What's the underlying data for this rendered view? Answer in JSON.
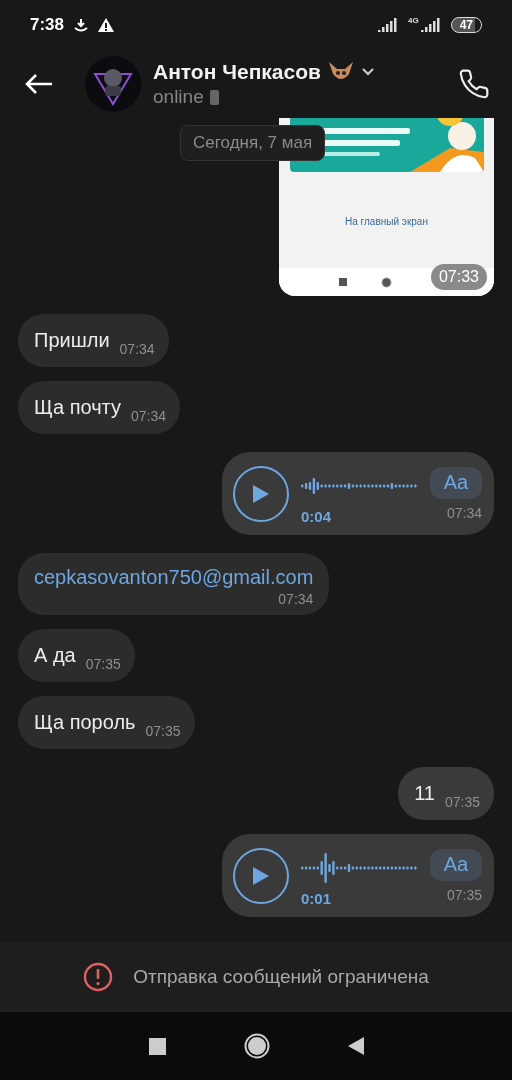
{
  "status_bar": {
    "time": "7:38",
    "network": "4G",
    "battery": "47"
  },
  "header": {
    "name": "Антон Чепкасов",
    "status": "online"
  },
  "date_divider": "Сегодня, 7 мая",
  "messages": [
    {
      "kind": "screenshot",
      "outgoing": true,
      "link": "На главный экран",
      "time": "07:33"
    },
    {
      "kind": "text",
      "outgoing": false,
      "text": "Пришли",
      "time": "07:34"
    },
    {
      "kind": "text",
      "outgoing": false,
      "text": "Ща почту",
      "time": "07:34"
    },
    {
      "kind": "voice",
      "outgoing": true,
      "duration": "0:04",
      "transcribe": "Aa",
      "time": "07:34"
    },
    {
      "kind": "link",
      "outgoing": false,
      "text": "cepkasovanton750@gmail.com",
      "time": "07:34"
    },
    {
      "kind": "text",
      "outgoing": false,
      "text": "А да",
      "time": "07:35"
    },
    {
      "kind": "text",
      "outgoing": false,
      "text": "Ща пороль",
      "time": "07:35"
    },
    {
      "kind": "text",
      "outgoing": true,
      "text": "11",
      "time": "07:35"
    },
    {
      "kind": "voice",
      "outgoing": true,
      "duration": "0:01",
      "transcribe": "Aa",
      "time": "07:35"
    }
  ],
  "restriction_notice": "Отправка сообщений ограничена"
}
